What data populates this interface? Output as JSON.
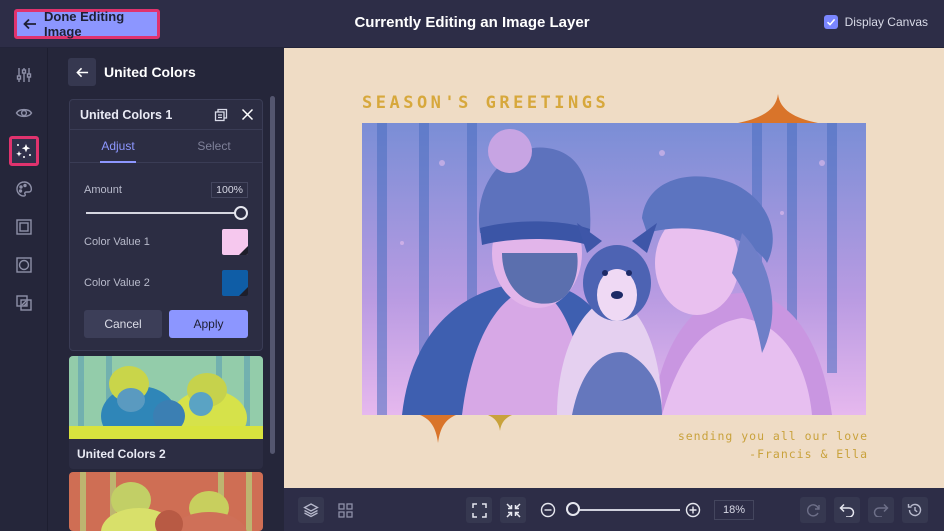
{
  "topbar": {
    "done_label": "Done Editing Image",
    "title": "Currently Editing an Image Layer",
    "display_canvas_label": "Display Canvas",
    "display_canvas_checked": true
  },
  "rail": {
    "items": [
      "adjust-sliders-icon",
      "eye-icon",
      "magic-effects-icon",
      "palette-icon",
      "frame-icon",
      "focus-frame-icon",
      "overlay-icon"
    ],
    "active": "magic-effects-icon"
  },
  "panel": {
    "title": "United Colors",
    "card": {
      "title": "United Colors 1",
      "tabs": [
        "Adjust",
        "Select"
      ],
      "active_tab": "Adjust",
      "amount_label": "Amount",
      "amount_value": "100%",
      "amount_fraction": 1.0,
      "color1_label": "Color Value 1",
      "color1": "#f6c8ee",
      "color2_label": "Color Value 2",
      "color2": "#0f5da6",
      "cancel_label": "Cancel",
      "apply_label": "Apply"
    },
    "presets": [
      {
        "label": "United Colors 2"
      }
    ]
  },
  "canvas": {
    "greeting": "SEASON'S GREETINGS",
    "line1": "sending you all our love",
    "line2": "-Francis & Ella"
  },
  "bottombar": {
    "zoom_value": "18%",
    "zoom_fraction": 0.0
  },
  "colors": {
    "accent": "#8c96ff",
    "highlight": "#e0336e",
    "canvas_bg": "#efdcc5",
    "greeting_gold": "#d7a83c",
    "ornament_orange": "#d9742a"
  }
}
